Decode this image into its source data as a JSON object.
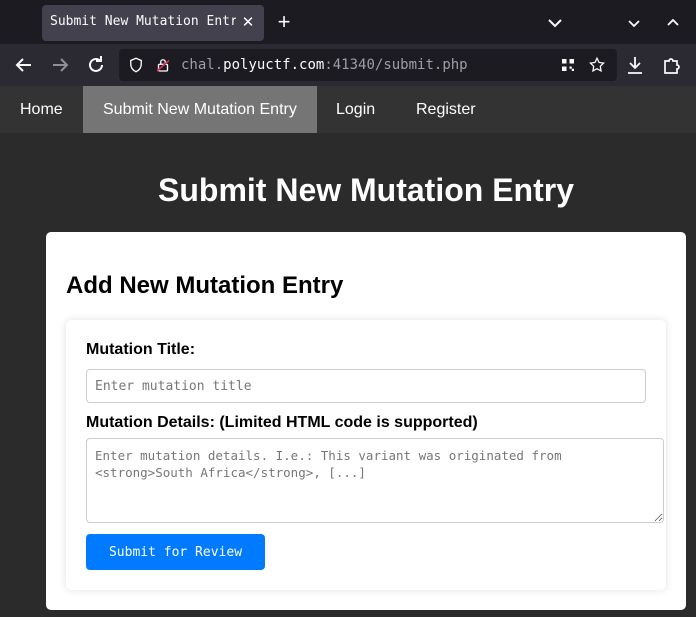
{
  "browser": {
    "tab_title": "Submit New Mutation Entry",
    "tab_close": "✕",
    "new_tab": "+",
    "url": {
      "prefix": "chal.",
      "host": "polyuctf.com",
      "suffix": ":41340/submit.php"
    },
    "icons": {
      "back": "back-arrow-icon",
      "forward": "forward-arrow-icon",
      "reload": "reload-icon",
      "shield": "shield-icon",
      "lock": "lock-icon",
      "qr": "qr-code-icon",
      "bookmark": "star-icon",
      "download": "download-icon",
      "extensions": "puzzle-icon"
    },
    "colors": {
      "tabbar": "#1c1b22",
      "active_tab": "#42414d",
      "navbar": "#2b2a33"
    }
  },
  "site_nav": {
    "items": [
      {
        "label": "Home",
        "active": false
      },
      {
        "label": "Submit New Mutation Entry",
        "active": true
      },
      {
        "label": "Login",
        "active": false
      },
      {
        "label": "Register",
        "active": false
      }
    ]
  },
  "page": {
    "title": "Submit New Mutation Entry",
    "form": {
      "heading": "Add New Mutation Entry",
      "title_label": "Mutation Title:",
      "title_placeholder": "Enter mutation title",
      "title_value": "",
      "details_label": "Mutation Details: (Limited HTML code is supported)",
      "details_placeholder": "Enter mutation details. I.e.: This variant was originated from <strong>South Africa</strong>, [...]",
      "details_value": "",
      "submit_label": "Submit for Review"
    },
    "colors": {
      "background": "#2b2b2b",
      "nav": "#333333",
      "nav_active": "#757575",
      "button": "#007bff"
    }
  }
}
